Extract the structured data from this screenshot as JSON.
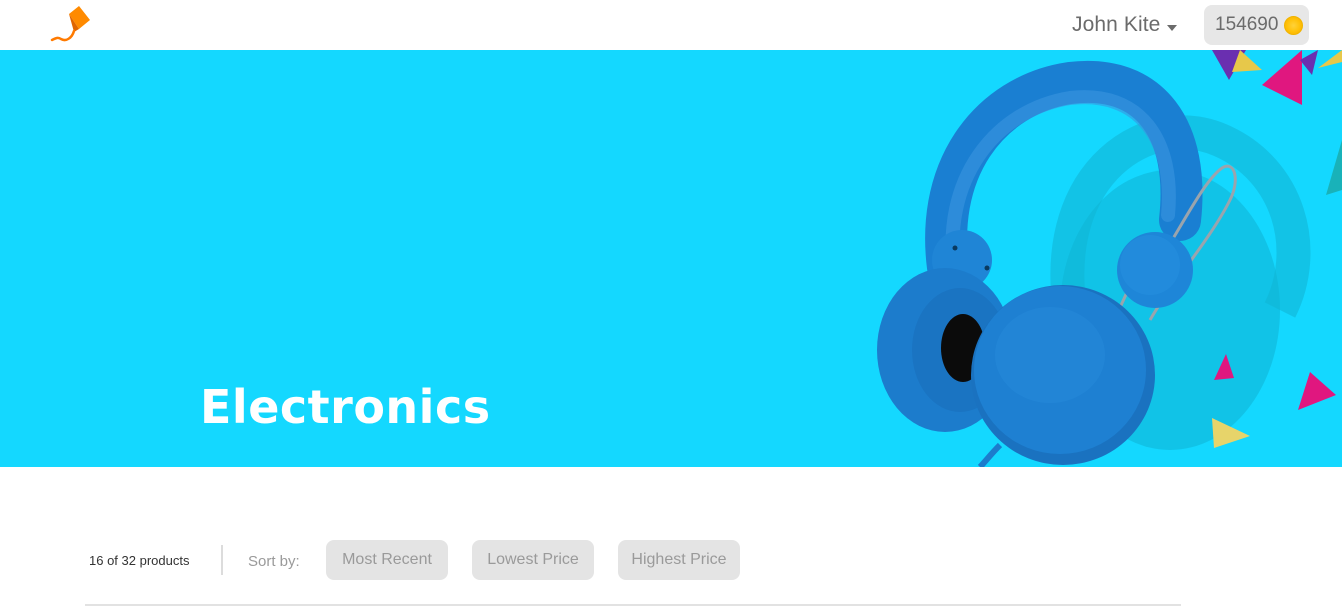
{
  "header": {
    "logo_icon": "kite-logo-icon",
    "brand_color": "#ff7a00",
    "user_name": "John Kite",
    "user_menu_icon": "caret-down-icon",
    "coin_balance": "154690",
    "coin_icon": "gold-coin-icon"
  },
  "banner": {
    "title": "Electronics",
    "background_color": "#14d8ff",
    "image": "blue-headphones-image"
  },
  "toolbar": {
    "product_count": "16 of 32 products",
    "sort_label": "Sort by:",
    "sort_options": [
      "Most Recent",
      "Lowest Price",
      "Highest Price"
    ]
  }
}
